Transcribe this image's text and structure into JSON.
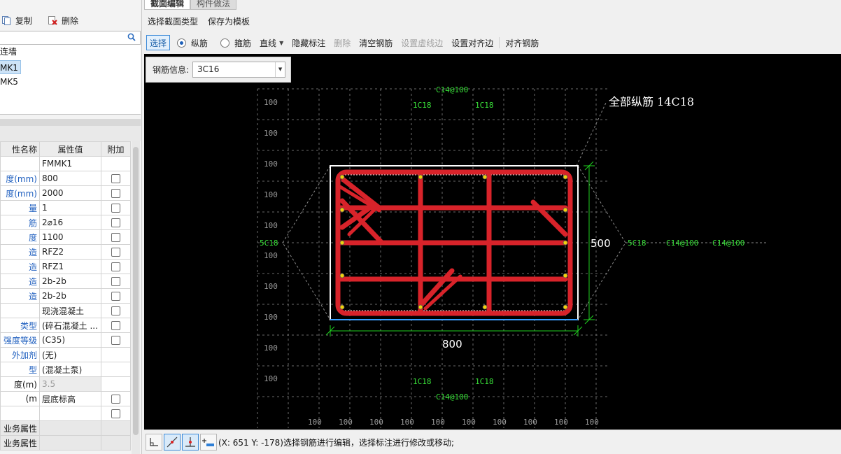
{
  "left_toolbar": {
    "copy_label": "复制",
    "delete_label": "删除"
  },
  "tree": {
    "items": [
      "连墙",
      "MK1",
      "MK5"
    ]
  },
  "props": {
    "headers": [
      "性名称",
      "属性值",
      "附加"
    ],
    "rows": [
      {
        "name": "",
        "value": "FMMK1",
        "check": false,
        "blue": false
      },
      {
        "name": "度(mm)",
        "value": "800",
        "check": true,
        "blue": true
      },
      {
        "name": "度(mm)",
        "value": "2000",
        "check": true,
        "blue": true
      },
      {
        "name": "量",
        "value": "1",
        "check": true,
        "blue": true
      },
      {
        "name": "筋",
        "value": "2⌀16",
        "check": true,
        "blue": true
      },
      {
        "name": "度",
        "value": "1100",
        "check": true,
        "blue": true
      },
      {
        "name": "造",
        "value": "RFZ2",
        "check": true,
        "blue": true
      },
      {
        "name": "造",
        "value": "RFZ1",
        "check": true,
        "blue": true
      },
      {
        "name": "造",
        "value": "2b-2b",
        "check": true,
        "blue": true
      },
      {
        "name": "造",
        "value": "2b-2b",
        "check": true,
        "blue": true
      },
      {
        "name": "",
        "value": "现浇混凝土",
        "check": true,
        "blue": false
      },
      {
        "name": "类型",
        "value": "(碎石混凝土 ...",
        "check": true,
        "blue": true
      },
      {
        "name": "强度等级",
        "value": "(C35)",
        "check": true,
        "blue": true
      },
      {
        "name": "外加剂",
        "value": "(无)",
        "check": false,
        "blue": true
      },
      {
        "name": "型",
        "value": "(混凝土泵)",
        "check": false,
        "blue": true
      },
      {
        "name": "度(m)",
        "value": "3.5",
        "check": false,
        "blue": false,
        "dim": true
      },
      {
        "name": "m)",
        "value": "层底标高",
        "check": true,
        "blue": false
      },
      {
        "name": "",
        "value": "",
        "check": true,
        "blue": false
      },
      {
        "name": "业务属性",
        "value": "",
        "check": false,
        "blue": false,
        "gray": true
      },
      {
        "name": "业务属性",
        "value": "",
        "check": false,
        "blue": false,
        "gray": true
      }
    ]
  },
  "tabs": [
    {
      "label": "截面编辑",
      "active": true
    },
    {
      "label": "构件做法",
      "active": false
    }
  ],
  "menu": {
    "select_section_type": "选择截面类型",
    "save_template": "保存为模板"
  },
  "tools": {
    "select": "选择",
    "longitudinal": "纵筋",
    "stirrup": "箍筋",
    "line": "直线",
    "hide_label": "隐藏标注",
    "delete": "删除",
    "clear_rebar": "清空钢筋",
    "set_dashed_edge": "设置虚线边",
    "set_align_edge": "设置对齐边",
    "align_rebar": "对齐钢筋"
  },
  "rebar_info": {
    "label": "钢筋信息:",
    "value": "3C16"
  },
  "drawing": {
    "total_label": "全部纵筋 14C18",
    "top_stirrup": "C14@100",
    "bottom_stirrup": "C14@100",
    "top_bars": [
      "1C18",
      "1C18"
    ],
    "bottom_bars": [
      "1C18",
      "1C18"
    ],
    "left_side": "5C18",
    "right_side": "5C18",
    "right_stirrup_1": "C14@100",
    "right_stirrup_2": "C14@100",
    "dim_width": "800",
    "dim_height": "500",
    "grid_label": "100",
    "colors": {
      "rebar": "#d8232a",
      "dimension": "#1fd01f",
      "label_green": "#39e039",
      "grid": "#6a6a6a",
      "section_border": "#ffffff",
      "bar_dot": "#f2d20c"
    }
  },
  "status": {
    "text": "(X: 651 Y: -178)选择钢筋进行编辑，选择标注进行修改或移动;"
  },
  "icons": [
    "copy-icon",
    "delete-icon",
    "search-icon",
    "snap-corner-icon",
    "snap-diagonal-icon",
    "snap-perpendicular-icon",
    "snap-offset-icon"
  ]
}
